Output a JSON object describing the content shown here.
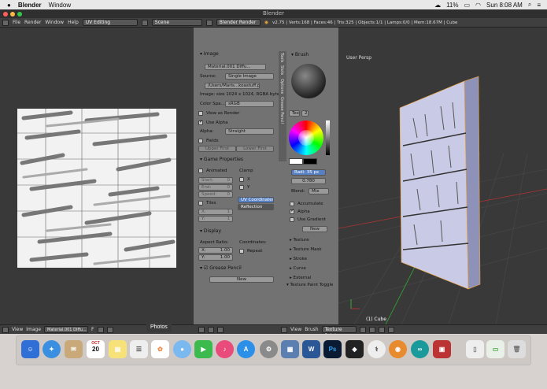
{
  "menubar": {
    "app_name": "Blender",
    "menu": "Window",
    "battery": "11%",
    "clock": "Sun 8:08 AM"
  },
  "titlebar": {
    "title": "Blender"
  },
  "infobar": {
    "file": "File",
    "render": "Render",
    "window": "Window",
    "help": "Help",
    "layout": "UV Editing",
    "scene": "Scene",
    "engine": "Blender Render",
    "stats": "v2.75 | Verts:168 | Faces:46 | Tris:325 | Objects:1/1 | Lamps:0/0 | Mem:18.67M | Cube"
  },
  "props": {
    "image_header": "Image",
    "material": "Material.001 Diffu...",
    "source_label": "Source:",
    "source_value": "Single Image",
    "path": "/Users/Maris...koastuff.png",
    "image_info": "Image: size 1024 x 1024, RGBA byte",
    "color_space_label": "Color Spa...",
    "color_space_value": "sRGB",
    "view_as_render": "View as Render",
    "use_alpha": "Use Alpha",
    "alpha_label": "Alpha:",
    "alpha_value": "Straight",
    "fields": "Fields",
    "upper_first": "Upper First",
    "lower_first": "Lower First",
    "game_props": "Game Properties",
    "animated": "Animated",
    "clamp": "Clamp",
    "start": "Start:",
    "end": "End:",
    "speed": "Speed:",
    "start_val": "0",
    "end_val": "0",
    "speed_val": "0",
    "x": "X",
    "y": "Y",
    "tiles": "Tiles",
    "uv_coordinates": "UV Coordinates",
    "reflection": "Reflection",
    "tx": "X:",
    "ty": "Y:",
    "tx_val": "1",
    "ty_val": "1",
    "display": "Display",
    "aspect_ratio": "Aspect Ratio:",
    "coordinates": "Coordinates:",
    "ax": "X:",
    "ay": "Y:",
    "ax_val": "1.00",
    "ay_val": "1.00",
    "repeat": "Repeat",
    "grease_pencil": "Grease Pencil",
    "new": "New"
  },
  "tools": {
    "brush": "Brush",
    "tex": "Tex",
    "num": "2",
    "radius": "Radi: 35 px",
    "strength": "0.780",
    "blend_label": "Blend:",
    "blend_value": "Mix",
    "accumulate": "Accumulate",
    "alpha": "Alpha",
    "use_gradient": "Use Gradient",
    "new": "New",
    "texture": "Texture",
    "texture_mask": "Texture Mask",
    "stroke": "Stroke",
    "curve": "Curve",
    "external": "External",
    "tp_toggle": "Texture Paint Toggle",
    "tabs": [
      "Tools",
      "Slots",
      "Options",
      "Grease Pencil"
    ]
  },
  "view3d": {
    "label": "User Persp",
    "object": "(1) Cube"
  },
  "bottom_uv": {
    "view": "View",
    "image": "Image",
    "material": "Material.001 Diffu...",
    "f": "F"
  },
  "bottom_3d": {
    "view": "View",
    "brush": "Brush",
    "mode": "Texture Paint"
  },
  "tooltip": "Photos",
  "dock": {
    "calendar_day": "20",
    "calendar_month": "OCT",
    "word": "W",
    "ps": "Ps"
  },
  "colors": {
    "accent": "#5680c2",
    "selected": "#f0a030"
  }
}
